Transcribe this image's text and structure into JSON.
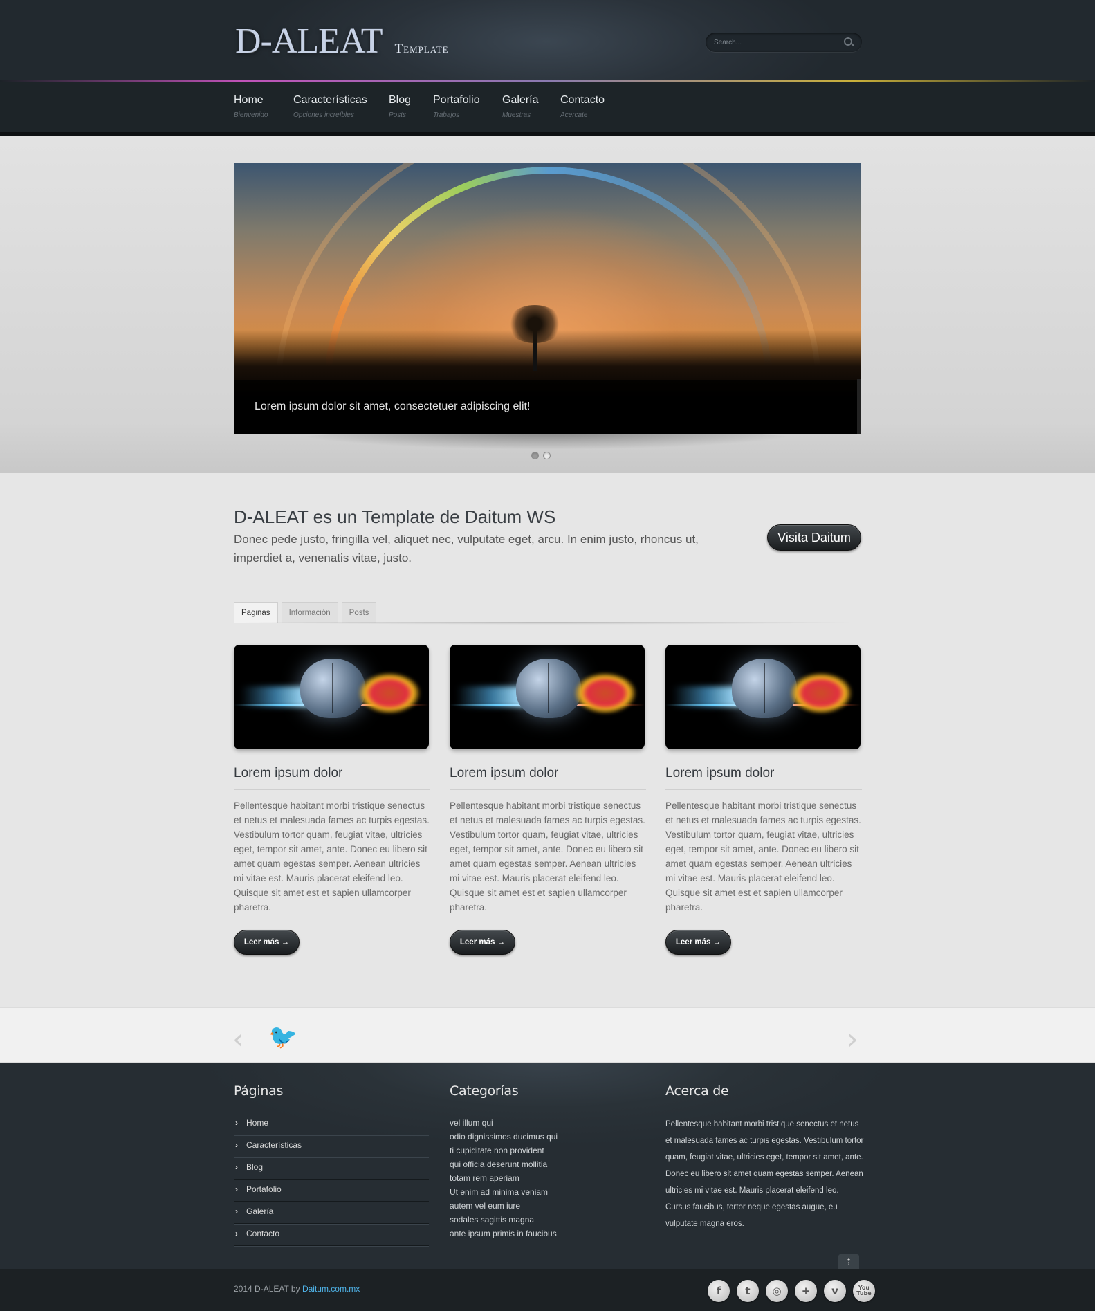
{
  "header": {
    "logo_main": "D-ALEAT",
    "logo_sub": "Template",
    "search_placeholder": "Search..."
  },
  "nav": [
    {
      "label": "Home",
      "sub": "Bienvenido"
    },
    {
      "label": "Características",
      "sub": "Opciones increíbles"
    },
    {
      "label": "Blog",
      "sub": "Posts"
    },
    {
      "label": "Portafolio",
      "sub": "Trabajos"
    },
    {
      "label": "Galería",
      "sub": "Muestras"
    },
    {
      "label": "Contacto",
      "sub": "Acercate"
    }
  ],
  "slider": {
    "caption": "Lorem ipsum dolor sit amet, consectetuer adipiscing elit!",
    "slide_count": 2,
    "active_slide": 1
  },
  "intro": {
    "title": "D-ALEAT es un Template de Daitum WS",
    "text": "Donec pede justo, fringilla vel, aliquet nec, vulputate eget, arcu. In enim justo, rhoncus ut, imperdiet a, venenatis vitae, justo.",
    "button": "Visita Daitum"
  },
  "tabs": [
    {
      "label": "Paginas",
      "active": true
    },
    {
      "label": "Información",
      "active": false
    },
    {
      "label": "Posts",
      "active": false
    }
  ],
  "cards": [
    {
      "title": "Lorem ipsum dolor",
      "text": "Pellentesque habitant morbi tristique senectus et netus et malesuada fames ac turpis egestas. Vestibulum tortor quam, feugiat vitae, ultricies eget, tempor sit amet, ante. Donec eu libero sit amet quam egestas semper. Aenean ultricies mi vitae est. Mauris placerat eleifend leo. Quisque sit amet est et sapien ullamcorper pharetra.",
      "button": "Leer más →"
    },
    {
      "title": "Lorem ipsum dolor",
      "text": "Pellentesque habitant morbi tristique senectus et netus et malesuada fames ac turpis egestas. Vestibulum tortor quam, feugiat vitae, ultricies eget, tempor sit amet, ante. Donec eu libero sit amet quam egestas semper. Aenean ultricies mi vitae est. Mauris placerat eleifend leo. Quisque sit amet est et sapien ullamcorper pharetra.",
      "button": "Leer más →"
    },
    {
      "title": "Lorem ipsum dolor",
      "text": "Pellentesque habitant morbi tristique senectus et netus et malesuada fames ac turpis egestas. Vestibulum tortor quam, feugiat vitae, ultricies eget, tempor sit amet, ante. Donec eu libero sit amet quam egestas semper. Aenean ultricies mi vitae est. Mauris placerat eleifend leo. Quisque sit amet est et sapien ullamcorper pharetra.",
      "button": "Leer más →"
    }
  ],
  "twitter_bar": {
    "prev_icon": "chevron-left-icon",
    "next_icon": "chevron-right-icon",
    "bird_icon": "twitter-bird-icon"
  },
  "footer": {
    "pages_title": "Páginas",
    "pages": [
      "Home",
      "Características",
      "Blog",
      "Portafolio",
      "Galería",
      "Contacto"
    ],
    "categories_title": "Categorías",
    "categories": [
      "vel illum qui",
      "odio dignissimos ducimus qui",
      "ti cupiditate non provident",
      "qui officia deserunt mollitia",
      "totam rem aperiam",
      "Ut enim ad minima veniam",
      "autem vel eum iure",
      "sodales sagittis magna",
      "ante ipsum primis in faucibus"
    ],
    "about_title": "Acerca de",
    "about_text": "Pellentesque habitant morbi tristique senectus et netus et malesuada fames ac turpis egestas. Vestibulum tortor quam, feugiat vitae, ultricies eget, tempor sit amet, ante. Donec eu libero sit amet quam egestas semper. Aenean ultricies mi vitae est. Mauris placerat eleifend leo. Cursus faucibus, tortor neque egestas augue, eu vulputate magna eros.",
    "to_top": "⇡"
  },
  "bottom": {
    "copyright_prefix": "2014 D-ALEAT by ",
    "copyright_link": "Daitum.com.mx",
    "social": [
      {
        "name": "facebook-icon",
        "glyph": "f"
      },
      {
        "name": "twitter-icon",
        "glyph": "t"
      },
      {
        "name": "dribbble-icon",
        "glyph": "◎"
      },
      {
        "name": "googleplus-icon",
        "glyph": "+"
      },
      {
        "name": "vimeo-icon",
        "glyph": "v"
      },
      {
        "name": "youtube-icon",
        "glyph": "You Tube"
      }
    ]
  }
}
